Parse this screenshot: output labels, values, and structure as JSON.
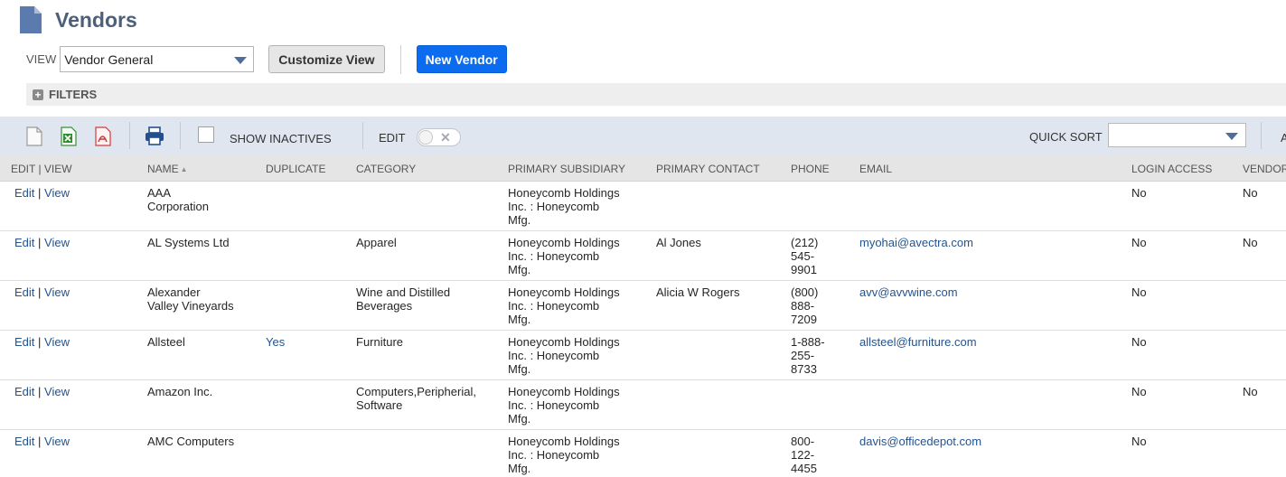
{
  "page": {
    "title": "Vendors",
    "icon": "document-icon"
  },
  "view": {
    "label": "VIEW",
    "selected": "Vendor General",
    "customize_label": "Customize View",
    "new_label": "New Vendor"
  },
  "filters": {
    "label": "FILTERS"
  },
  "toolbar": {
    "show_inactives": "SHOW INACTIVES",
    "edit_label": "EDIT",
    "quick_sort_label": "QUICK SORT",
    "quick_sort_value": "",
    "truncated_label": "A",
    "icons": [
      "new-document-icon",
      "excel-export-icon",
      "pdf-export-icon",
      "print-icon"
    ]
  },
  "columns": {
    "edit_view": "EDIT | VIEW",
    "name": "NAME",
    "duplicate": "DUPLICATE",
    "category": "CATEGORY",
    "subsidiary": "PRIMARY SUBSIDIARY",
    "contact": "PRIMARY CONTACT",
    "phone": "PHONE",
    "email": "EMAIL",
    "login": "LOGIN ACCESS",
    "vendor": "VENDOR"
  },
  "row_links": {
    "edit": "Edit",
    "sep": "|",
    "view": "View"
  },
  "rows": [
    {
      "name": "AAA\nCorporation",
      "duplicate": "",
      "category": "",
      "subsidiary": "Honeycomb Holdings\nInc. : Honeycomb\nMfg.",
      "contact": "",
      "phone": "",
      "email": "",
      "login": "No",
      "vendor": "No"
    },
    {
      "name": "AL Systems Ltd",
      "duplicate": "",
      "category": "Apparel",
      "subsidiary": "Honeycomb Holdings\nInc. : Honeycomb\nMfg.",
      "contact": "Al Jones",
      "phone": "(212)\n545-\n9901",
      "email": "myohai@avectra.com",
      "login": "No",
      "vendor": "No"
    },
    {
      "name": "Alexander\nValley Vineyards",
      "duplicate": "",
      "category": "Wine and Distilled\nBeverages",
      "subsidiary": "Honeycomb Holdings\nInc. : Honeycomb\nMfg.",
      "contact": "Alicia W Rogers",
      "phone": "(800)\n888-\n7209",
      "email": "avv@avvwine.com",
      "login": "No",
      "vendor": ""
    },
    {
      "name": "Allsteel",
      "duplicate": "Yes",
      "category": "Furniture",
      "subsidiary": "Honeycomb Holdings\nInc. : Honeycomb\nMfg.",
      "contact": "",
      "phone": "1-888-\n255-\n8733",
      "email": "allsteel@furniture.com",
      "login": "No",
      "vendor": ""
    },
    {
      "name": "Amazon Inc.",
      "duplicate": "",
      "category": "Computers,Peripherial,\nSoftware",
      "subsidiary": "Honeycomb Holdings\nInc. : Honeycomb\nMfg.",
      "contact": "",
      "phone": "",
      "email": "",
      "login": "No",
      "vendor": "No"
    },
    {
      "name": "AMC Computers",
      "duplicate": "",
      "category": "",
      "subsidiary": "Honeycomb Holdings\nInc. : Honeycomb\nMfg.",
      "contact": "",
      "phone": "800-\n122-\n4455",
      "email": "davis@officedepot.com",
      "login": "No",
      "vendor": ""
    }
  ]
}
